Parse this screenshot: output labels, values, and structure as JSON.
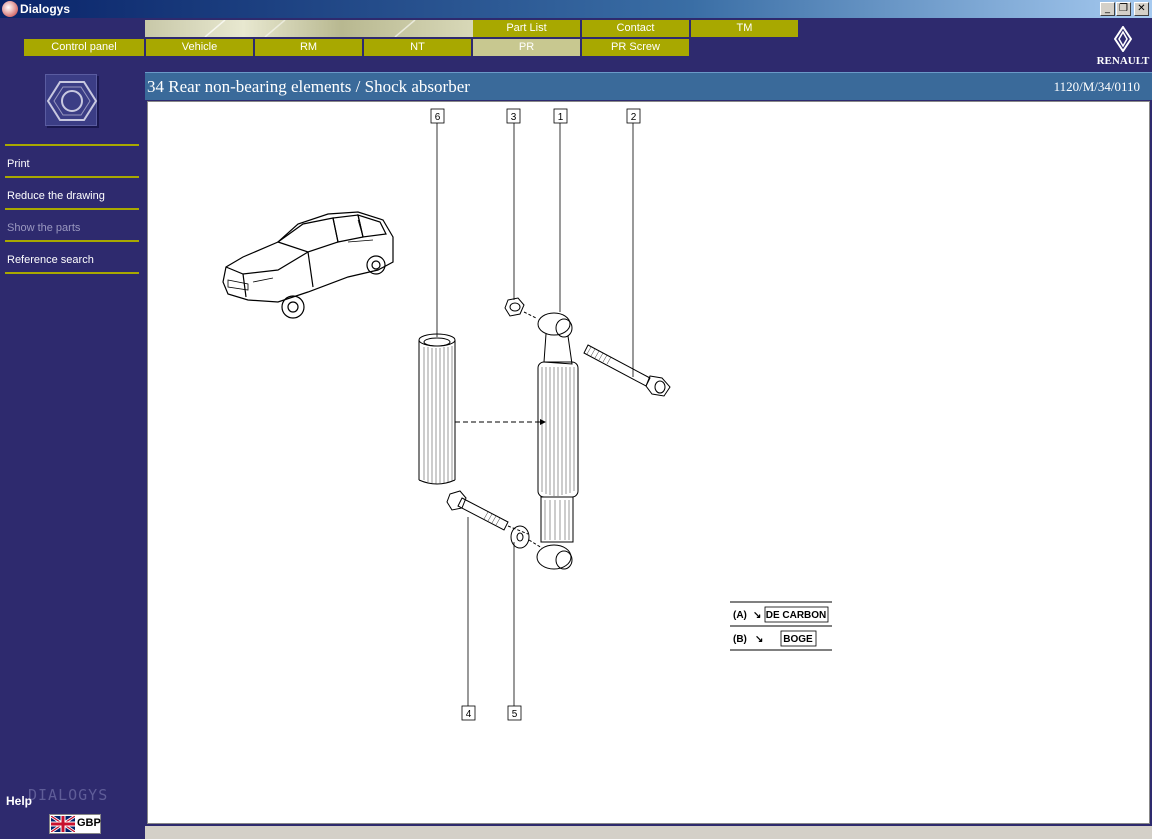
{
  "window": {
    "title": "Dialogys",
    "controls": [
      "_",
      "❐",
      "✕"
    ]
  },
  "top_tabs": [
    "Part List",
    "Contact",
    "TM"
  ],
  "main_tabs": [
    {
      "label": "Control panel",
      "active": false
    },
    {
      "label": "Vehicle",
      "active": false
    },
    {
      "label": "RM",
      "active": false
    },
    {
      "label": "NT",
      "active": false
    },
    {
      "label": "PR",
      "active": true
    },
    {
      "label": "PR Screw",
      "active": false
    }
  ],
  "brand": {
    "name": "RENAULT"
  },
  "sidebar": {
    "icon": "hex-nut-icon",
    "items": [
      {
        "label": "Print",
        "enabled": true
      },
      {
        "label": "Reduce the drawing",
        "enabled": true
      },
      {
        "label": "Show the parts",
        "enabled": false
      },
      {
        "label": "Reference search",
        "enabled": true
      }
    ],
    "help_label": "Help",
    "watermark": "DIALOGYS",
    "currency": "GBP"
  },
  "header": {
    "title": "34 Rear non-bearing elements / Shock absorber",
    "reference": "1120/M/34/0110"
  },
  "drawing": {
    "callouts": [
      "6",
      "3",
      "1",
      "2",
      "4",
      "5"
    ],
    "legend": [
      {
        "key": "(A)",
        "value": "DE CARBON"
      },
      {
        "key": "(B)",
        "value": "BOGE"
      }
    ]
  },
  "colors": {
    "background": "#2e2a6e",
    "tab": "#a8a800",
    "tab_active": "#c8c890",
    "header": "#3a6a9a"
  }
}
